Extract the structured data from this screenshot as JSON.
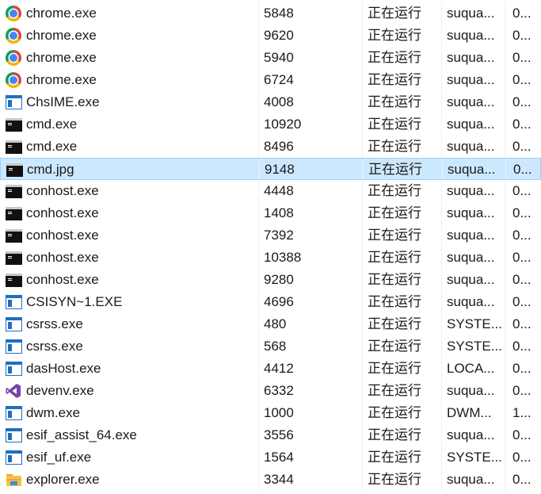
{
  "rows": [
    {
      "name": "chrome.exe",
      "icon": "chrome-icon",
      "pid": "5848",
      "status": "正在运行",
      "user": "suqua...",
      "cpu": "0..."
    },
    {
      "name": "chrome.exe",
      "icon": "chrome-icon",
      "pid": "9620",
      "status": "正在运行",
      "user": "suqua...",
      "cpu": "0..."
    },
    {
      "name": "chrome.exe",
      "icon": "chrome-icon",
      "pid": "5940",
      "status": "正在运行",
      "user": "suqua...",
      "cpu": "0..."
    },
    {
      "name": "chrome.exe",
      "icon": "chrome-icon",
      "pid": "6724",
      "status": "正在运行",
      "user": "suqua...",
      "cpu": "0..."
    },
    {
      "name": "ChsIME.exe",
      "icon": "app-window-icon",
      "pid": "4008",
      "status": "正在运行",
      "user": "suqua...",
      "cpu": "0..."
    },
    {
      "name": "cmd.exe",
      "icon": "console-icon",
      "pid": "10920",
      "status": "正在运行",
      "user": "suqua...",
      "cpu": "0..."
    },
    {
      "name": "cmd.exe",
      "icon": "console-icon",
      "pid": "8496",
      "status": "正在运行",
      "user": "suqua...",
      "cpu": "0..."
    },
    {
      "name": "cmd.jpg",
      "icon": "console-icon",
      "pid": "9148",
      "status": "正在运行",
      "user": "suqua...",
      "cpu": "0...",
      "selected": true
    },
    {
      "name": "conhost.exe",
      "icon": "console-icon",
      "pid": "4448",
      "status": "正在运行",
      "user": "suqua...",
      "cpu": "0..."
    },
    {
      "name": "conhost.exe",
      "icon": "console-icon",
      "pid": "1408",
      "status": "正在运行",
      "user": "suqua...",
      "cpu": "0..."
    },
    {
      "name": "conhost.exe",
      "icon": "console-icon",
      "pid": "7392",
      "status": "正在运行",
      "user": "suqua...",
      "cpu": "0..."
    },
    {
      "name": "conhost.exe",
      "icon": "console-icon",
      "pid": "10388",
      "status": "正在运行",
      "user": "suqua...",
      "cpu": "0..."
    },
    {
      "name": "conhost.exe",
      "icon": "console-icon",
      "pid": "9280",
      "status": "正在运行",
      "user": "suqua...",
      "cpu": "0..."
    },
    {
      "name": "CSISYN~1.EXE",
      "icon": "app-window-icon",
      "pid": "4696",
      "status": "正在运行",
      "user": "suqua...",
      "cpu": "0..."
    },
    {
      "name": "csrss.exe",
      "icon": "app-window-icon",
      "pid": "480",
      "status": "正在运行",
      "user": "SYSTE...",
      "cpu": "0..."
    },
    {
      "name": "csrss.exe",
      "icon": "app-window-icon",
      "pid": "568",
      "status": "正在运行",
      "user": "SYSTE...",
      "cpu": "0..."
    },
    {
      "name": "dasHost.exe",
      "icon": "app-window-icon",
      "pid": "4412",
      "status": "正在运行",
      "user": "LOCA...",
      "cpu": "0..."
    },
    {
      "name": "devenv.exe",
      "icon": "visual-studio-icon",
      "pid": "6332",
      "status": "正在运行",
      "user": "suqua...",
      "cpu": "0..."
    },
    {
      "name": "dwm.exe",
      "icon": "app-window-icon",
      "pid": "1000",
      "status": "正在运行",
      "user": "DWM...",
      "cpu": "1..."
    },
    {
      "name": "esif_assist_64.exe",
      "icon": "app-window-icon",
      "pid": "3556",
      "status": "正在运行",
      "user": "suqua...",
      "cpu": "0..."
    },
    {
      "name": "esif_uf.exe",
      "icon": "app-window-icon",
      "pid": "1564",
      "status": "正在运行",
      "user": "SYSTE...",
      "cpu": "0..."
    },
    {
      "name": "explorer.exe",
      "icon": "folder-icon",
      "pid": "3344",
      "status": "正在运行",
      "user": "suqua...",
      "cpu": "0..."
    }
  ]
}
